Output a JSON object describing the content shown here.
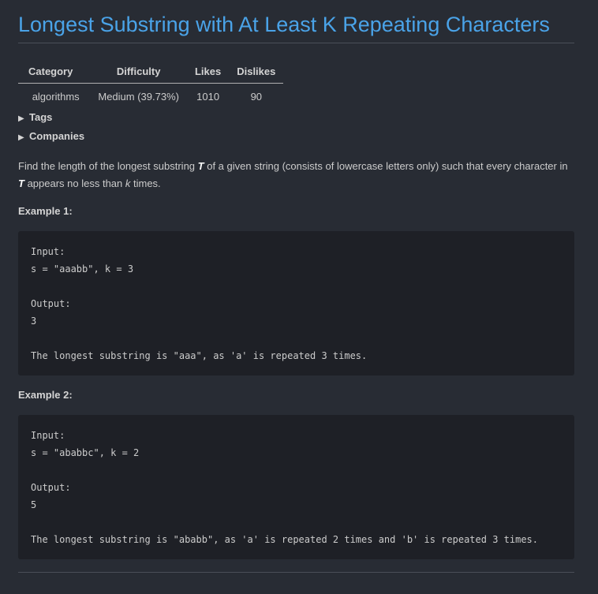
{
  "title": "Longest Substring with At Least K Repeating Characters",
  "meta": {
    "headers": [
      "Category",
      "Difficulty",
      "Likes",
      "Dislikes"
    ],
    "row": [
      "algorithms",
      "Medium (39.73%)",
      "1010",
      "90"
    ]
  },
  "tags_label": "Tags",
  "companies_label": "Companies",
  "description": {
    "part1": "Find the length of the longest substring ",
    "T1": "T",
    "part2": " of a given string (consists of lowercase letters only) such that every character in ",
    "T2": "T",
    "part3": " appears no less than ",
    "k": "k",
    "part4": " times."
  },
  "examples": [
    {
      "heading": "Example 1:",
      "code": "Input:\ns = \"aaabb\", k = 3\n\nOutput:\n3\n\nThe longest substring is \"aaa\", as 'a' is repeated 3 times."
    },
    {
      "heading": "Example 2:",
      "code": "Input:\ns = \"ababbc\", k = 2\n\nOutput:\n5\n\nThe longest substring is \"ababb\", as 'a' is repeated 2 times and 'b' is repeated 3 times."
    }
  ]
}
